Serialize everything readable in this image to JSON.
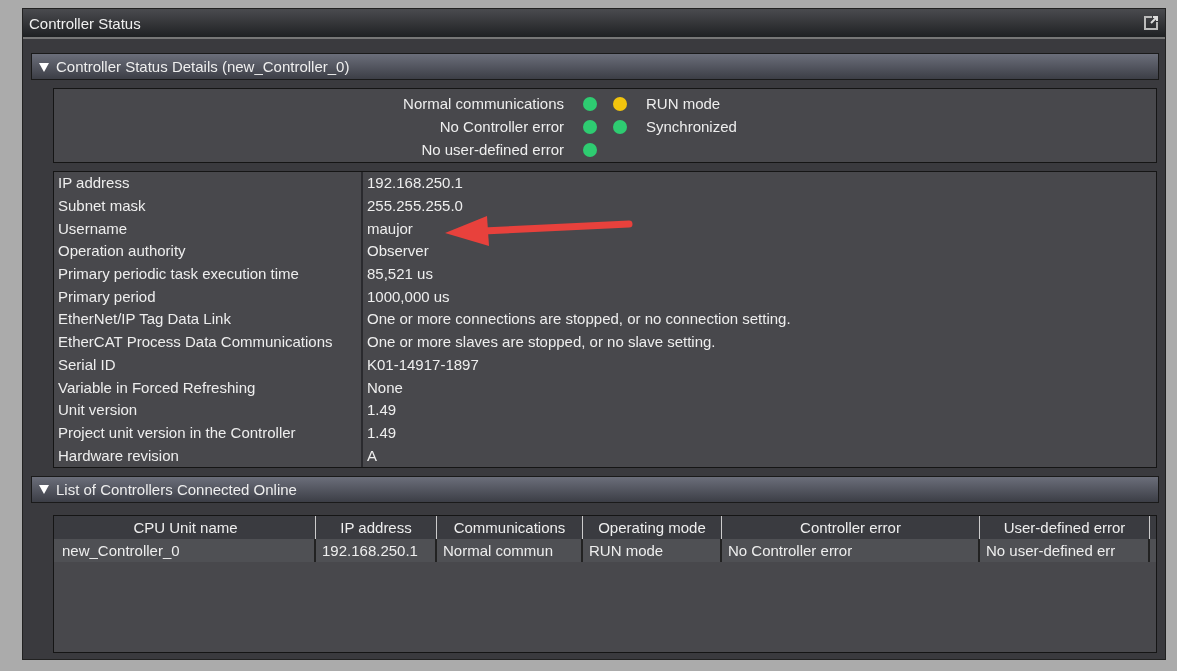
{
  "window": {
    "title": "Controller Status"
  },
  "details": {
    "title": "Controller Status Details (new_Controller_0)",
    "expanded": true,
    "status_left": [
      {
        "label": "Normal communications",
        "color": "#2ecc71"
      },
      {
        "label": "No Controller error",
        "color": "#2ecc71"
      },
      {
        "label": "No user-defined error",
        "color": "#2ecc71"
      }
    ],
    "status_right": [
      {
        "label": "RUN mode",
        "color": "#f2c40d"
      },
      {
        "label": "Synchronized",
        "color": "#2ecc71"
      }
    ],
    "properties": [
      {
        "name": "IP address",
        "value": "192.168.250.1"
      },
      {
        "name": "Subnet mask",
        "value": "255.255.255.0"
      },
      {
        "name": "Username",
        "value": "maujor"
      },
      {
        "name": "Operation authority",
        "value": "Observer"
      },
      {
        "name": "Primary periodic task execution time",
        "value": "85,521 us"
      },
      {
        "name": "Primary period",
        "value": "1000,000 us"
      },
      {
        "name": "EtherNet/IP Tag Data Link",
        "value": "One or more connections are stopped, or no connection setting."
      },
      {
        "name": "EtherCAT Process Data Communications",
        "value": "One or more slaves are stopped, or no slave setting."
      },
      {
        "name": "Serial ID",
        "value": "K01-14917-1897"
      },
      {
        "name": "Variable in Forced Refreshing",
        "value": "None"
      },
      {
        "name": "Unit version",
        "value": "1.49"
      },
      {
        "name": "Project unit version in the Controller",
        "value": "1.49"
      },
      {
        "name": "Hardware revision",
        "value": "A"
      }
    ]
  },
  "online": {
    "title": "List of Controllers Connected Online",
    "expanded": true,
    "columns": [
      "CPU Unit name",
      "IP address",
      "Communications",
      "Operating mode",
      "Controller error",
      "User-defined error"
    ],
    "rows": [
      [
        "new_Controller_0",
        "192.168.250.1",
        "Normal commun",
        "RUN mode",
        "No Controller error",
        "No user-defined err"
      ]
    ]
  }
}
